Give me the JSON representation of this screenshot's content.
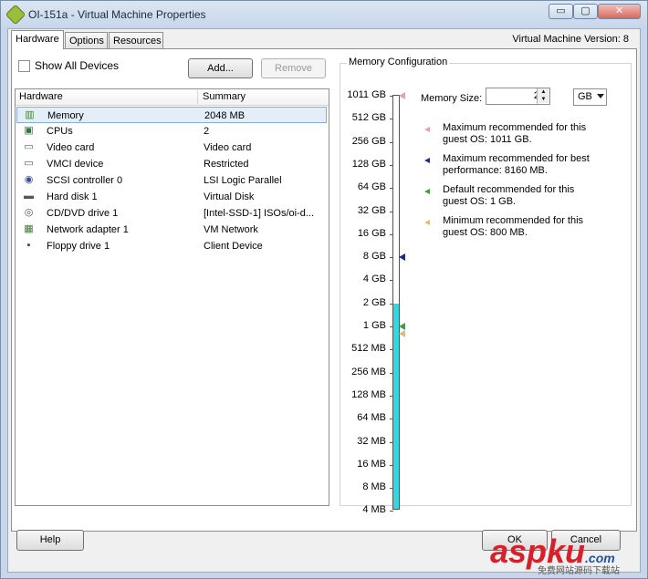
{
  "window": {
    "title": "OI-151a - Virtual Machine Properties",
    "minimize_glyph": "▭",
    "maximize_glyph": "▢",
    "close_glyph": "✕"
  },
  "tabs": [
    {
      "label": "Hardware",
      "active": true
    },
    {
      "label": "Options",
      "active": false
    },
    {
      "label": "Resources",
      "active": false
    }
  ],
  "vm_version": "Virtual Machine Version: 8",
  "hardware": {
    "show_all_devices_label": "Show All Devices",
    "show_all_devices_checked": false,
    "add_label": "Add...",
    "remove_label": "Remove",
    "columns": [
      "Hardware",
      "Summary"
    ],
    "devices": [
      {
        "name": "Memory",
        "summary": "2048 MB",
        "icon": "memory-icon",
        "selected": true
      },
      {
        "name": "CPUs",
        "summary": "2",
        "icon": "cpu-icon"
      },
      {
        "name": "Video card",
        "summary": "Video card",
        "icon": "monitor-icon"
      },
      {
        "name": "VMCI device",
        "summary": "Restricted",
        "icon": "vmci-icon"
      },
      {
        "name": "SCSI controller 0",
        "summary": "LSI Logic Parallel",
        "icon": "scsi-icon"
      },
      {
        "name": "Hard disk 1",
        "summary": "Virtual Disk",
        "icon": "hard-disk-icon"
      },
      {
        "name": "CD/DVD drive 1",
        "summary": "[Intel-SSD-1] ISOs/oi-d...",
        "icon": "cd-dvd-icon"
      },
      {
        "name": "Network adapter 1",
        "summary": "VM Network",
        "icon": "network-adapter-icon"
      },
      {
        "name": "Floppy drive 1",
        "summary": "Client Device",
        "icon": "floppy-icon"
      }
    ]
  },
  "memory_config": {
    "group_label": "Memory Configuration",
    "memory_size_label": "Memory Size:",
    "memory_size_value": "2",
    "unit": "GB",
    "scale_labels": [
      "1011 GB",
      "512 GB",
      "256 GB",
      "128 GB",
      "64 GB",
      "32 GB",
      "16 GB",
      "8 GB",
      "4 GB",
      "2 GB",
      "1 GB",
      "512 MB",
      "256 MB",
      "128 MB",
      "64 MB",
      "32 MB",
      "16 MB",
      "8 MB",
      "4 MB"
    ],
    "legend": [
      {
        "line1": "Maximum recommended for this",
        "line2": "guest OS: 1011 GB.",
        "color": "#e8a0a8"
      },
      {
        "line1": "Maximum recommended for best",
        "line2": "performance: 8160 MB.",
        "color": "#1c2a8a"
      },
      {
        "line1": "Default recommended for this",
        "line2": "guest OS: 1 GB.",
        "color": "#3ca03c"
      },
      {
        "line1": "Minimum recommended for this",
        "line2": "guest OS: 800 MB.",
        "color": "#e8b878"
      }
    ]
  },
  "footer": {
    "help_label": "Help",
    "ok_label": "OK",
    "cancel_label": "Cancel"
  },
  "watermark": {
    "brand": "aspku",
    "suffix": ".com",
    "sub": "免费网站源码下载站"
  }
}
